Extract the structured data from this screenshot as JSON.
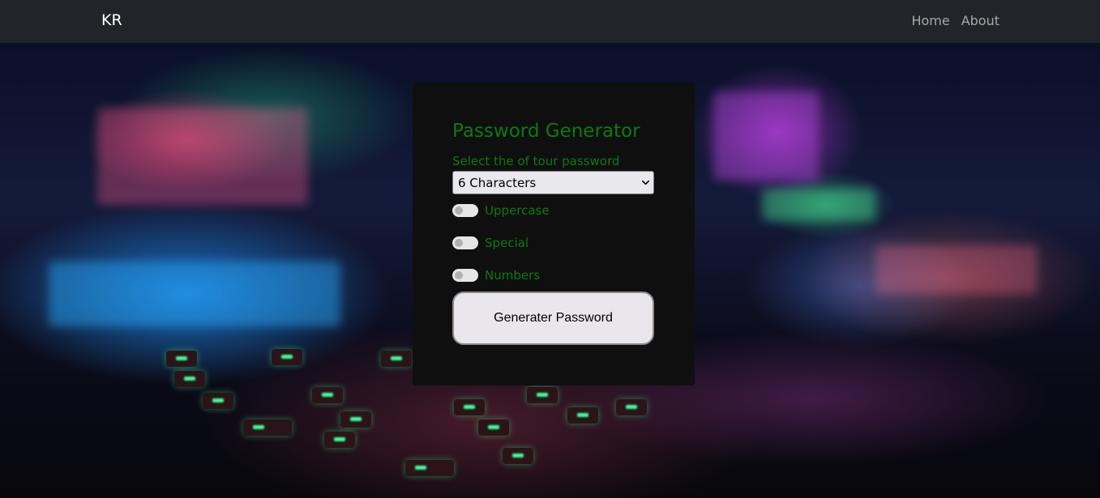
{
  "navbar": {
    "brand": "KR",
    "links": [
      {
        "label": "Home"
      },
      {
        "label": "About"
      }
    ]
  },
  "generator": {
    "title": "Password Generator",
    "select_label": "Select the of tour password",
    "length_selected": "6 Characters",
    "toggles": [
      {
        "label": "Uppercase",
        "checked": false
      },
      {
        "label": "Special",
        "checked": false
      },
      {
        "label": "Numbers",
        "checked": false
      }
    ],
    "button_label": "Generater Password"
  },
  "colors": {
    "navbar_bg": "#212529",
    "card_bg": "#0f0f10",
    "accent_green": "#0e7a0d",
    "button_bg": "#e9e7ec"
  },
  "icons": {
    "select_chevron": "chevron-down-icon"
  }
}
